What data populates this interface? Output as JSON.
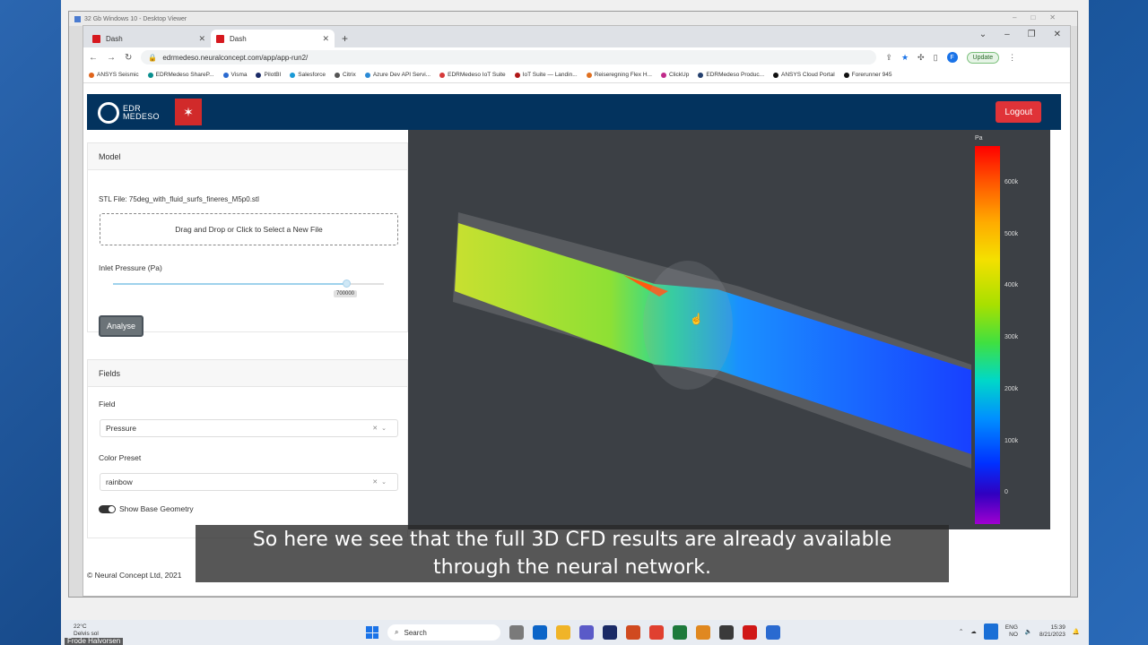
{
  "viewer": {
    "title": "32 Gb Windows 10 - Desktop Viewer"
  },
  "browser": {
    "tabs": [
      {
        "label": "Dash"
      },
      {
        "label": "Dash"
      }
    ],
    "url": "edrmedeso.neuralconcept.com/app/app-run2/",
    "update_label": "Update",
    "profile_initial": "F",
    "bookmarks": [
      "ANSYS Seismic",
      "EDRMedeso ShareP...",
      "Visma",
      "PilotBI",
      "Salesforce",
      "Citrix",
      "Azure Dev API Servi...",
      "EDRMedeso IoT Suite",
      "IoT Suite — Landin...",
      "Reiseregning Flex H...",
      "ClickUp",
      "EDRMedeso Produc...",
      "ANSYS Cloud Portal",
      "Forerunner 945"
    ]
  },
  "app": {
    "logo_text_1": "EDR",
    "logo_text_2": "MEDESO",
    "logout_label": "Logout",
    "model": {
      "header": "Model",
      "stl_file": "STL File: 75deg_with_fluid_surfs_fineres_M5p0.stl",
      "dropzone": "Drag and Drop or Click to Select a New File",
      "inlet_label": "Inlet Pressure (Pa)",
      "inlet_value": "700000",
      "slider_fraction": 0.86,
      "analyse_label": "Analyse"
    },
    "fields": {
      "header": "Fields",
      "field_label": "Field",
      "field_value": "Pressure",
      "preset_label": "Color Preset",
      "preset_value": "rainbow",
      "toggle_label": "Show Base Geometry"
    },
    "footer": "© Neural Concept Ltd, 2021",
    "colorbar": {
      "unit": "Pa",
      "ticks": [
        "600k",
        "500k",
        "400k",
        "300k",
        "200k",
        "100k",
        "0"
      ]
    }
  },
  "subtitle": {
    "line1": "So here we see that the full 3D CFD results are already available",
    "line2": "through the neural network."
  },
  "taskbar": {
    "weather_temp": "22°C",
    "weather_desc": "Delvis sol",
    "search_label": "Search",
    "lang_1": "ENG",
    "lang_2": "NO",
    "time": "15:39",
    "date": "8/21/2023",
    "user_name": "Frode Halvorsen"
  }
}
